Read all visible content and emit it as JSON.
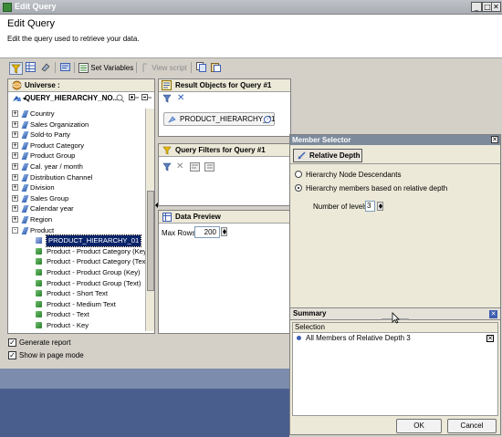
{
  "window": {
    "title": "Edit Query",
    "min_glyph": "_",
    "max_glyph": "□",
    "close_glyph": "✕"
  },
  "header": {
    "title": "Edit Query",
    "subtitle": "Edit the query used to retrieve your data."
  },
  "toolbar": {
    "set_variables": "Set Variables",
    "view_script": "View script"
  },
  "universe": {
    "title": "Universe : QUERY_HIERARCHY_NO...",
    "tree": [
      {
        "label": "Country",
        "kind": "dim",
        "expander": "+"
      },
      {
        "label": "Sales Organization",
        "kind": "dim",
        "expander": "+"
      },
      {
        "label": "Sold-to Party",
        "kind": "dim",
        "expander": "+"
      },
      {
        "label": "Product Category",
        "kind": "dim",
        "expander": "+"
      },
      {
        "label": "Product Group",
        "kind": "dim",
        "expander": "+"
      },
      {
        "label": "Cal. year / month",
        "kind": "dim",
        "expander": "+"
      },
      {
        "label": "Distribution Channel",
        "kind": "dim",
        "expander": "+"
      },
      {
        "label": "Division",
        "kind": "dim",
        "expander": "+"
      },
      {
        "label": "Sales Group",
        "kind": "dim",
        "expander": "+"
      },
      {
        "label": "Calendar year",
        "kind": "dim",
        "expander": "+"
      },
      {
        "label": "Region",
        "kind": "dim",
        "expander": "+"
      },
      {
        "label": "Product",
        "kind": "dim",
        "expander": "-"
      },
      {
        "label": "PRODUCT_HIERARCHY_01",
        "kind": "hier",
        "selected": true
      },
      {
        "label": "Product - Product Category (Key)",
        "kind": "attr"
      },
      {
        "label": "Product - Product Category (Text",
        "kind": "attr"
      },
      {
        "label": "Product - Product Group (Key)",
        "kind": "attr"
      },
      {
        "label": "Product - Product Group (Text)",
        "kind": "attr"
      },
      {
        "label": "Product - Short Text",
        "kind": "attr"
      },
      {
        "label": "Product - Medium Text",
        "kind": "attr"
      },
      {
        "label": "Product - Text",
        "kind": "attr"
      },
      {
        "label": "Product - Key",
        "kind": "attr"
      }
    ]
  },
  "options": {
    "generate_report": "Generate report",
    "show_in_page_mode": "Show in page mode"
  },
  "result_objects": {
    "title": "Result Objects for Query #1",
    "chip": "PRODUCT_HIERARCHY_01"
  },
  "query_filters": {
    "title": "Query Filters for Query #1"
  },
  "data_preview": {
    "title": "Data Preview",
    "max_rows_label": "Max Rows",
    "max_rows_value": "200"
  },
  "member_selector": {
    "title": "Member Selector",
    "tab": "Relative Depth",
    "opt_descendants": "Hierarchy Node Descendants",
    "opt_relative": "Hierarchy members based on relative depth",
    "levels_label": "Number of levels",
    "levels_value": "3",
    "summary_title": "Summary",
    "selection_header": "Selection",
    "selection_item": "All Members of Relative Depth 3",
    "ok": "OK",
    "cancel": "Cancel"
  }
}
